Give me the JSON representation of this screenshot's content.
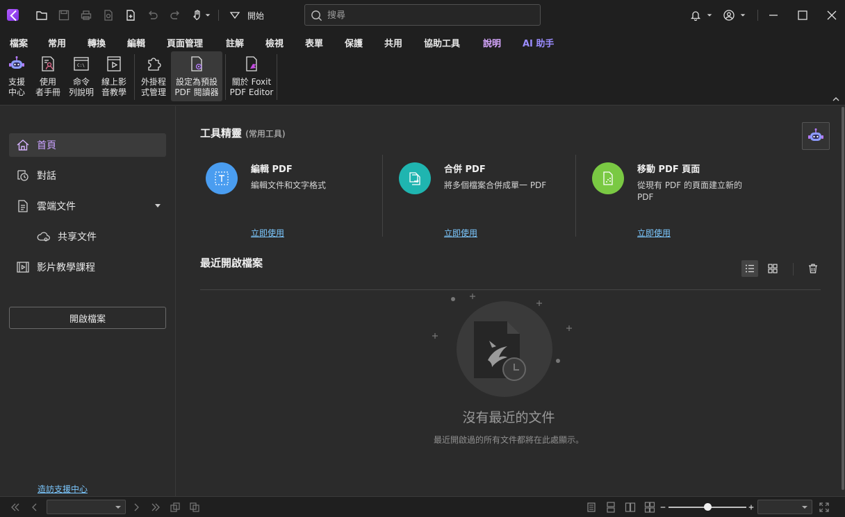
{
  "titlebar": {
    "mode_label": "開始",
    "search_placeholder": "搜尋"
  },
  "menu": {
    "tabs": [
      {
        "label": "檔案"
      },
      {
        "label": "常用"
      },
      {
        "label": "轉換"
      },
      {
        "label": "編輯"
      },
      {
        "label": "頁面管理"
      },
      {
        "label": "註解"
      },
      {
        "label": "檢視"
      },
      {
        "label": "表單"
      },
      {
        "label": "保護"
      },
      {
        "label": "共用"
      },
      {
        "label": "協助工具"
      },
      {
        "label": "說明"
      },
      {
        "label": "AI 助手"
      }
    ],
    "active_tab": "說明"
  },
  "ribbon": {
    "buttons": [
      {
        "label": "支援\n中心",
        "icon": "robot-support-icon"
      },
      {
        "label": "使用\n者手冊",
        "icon": "user-manual-icon"
      },
      {
        "label": "命令\n列說明",
        "icon": "command-line-icon"
      },
      {
        "label": "線上影\n音教學",
        "icon": "video-tutorial-icon"
      },
      {
        "label": "外掛程\n式管理",
        "icon": "plugin-icon"
      },
      {
        "label": "設定為預設\nPDF 閱讀器",
        "icon": "default-reader-icon"
      },
      {
        "label": "關於 Foxit\nPDF Editor",
        "icon": "about-foxit-icon"
      }
    ]
  },
  "sidebar": {
    "items": [
      {
        "label": "首頁",
        "icon": "home-icon"
      },
      {
        "label": "對話",
        "icon": "chat-icon"
      },
      {
        "label": "雲端文件",
        "icon": "cloud-document-icon"
      },
      {
        "label": "共享文件",
        "icon": "cloud-shared-icon"
      },
      {
        "label": "影片教學課程",
        "icon": "video-course-icon"
      }
    ],
    "open_file_label": "開啟檔案",
    "support_link": "造訪支援中心"
  },
  "main": {
    "tools_title": "工具精靈",
    "tools_subtitle": "(常用工具)",
    "tools": [
      {
        "title": "編輯 PDF",
        "desc": "編輯文件和文字格式",
        "link": "立即使用",
        "color": "#4a9df0",
        "icon": "edit-text-icon"
      },
      {
        "title": "合併 PDF",
        "desc": "將多個檔案合併成單一 PDF",
        "link": "立即使用",
        "color": "#1fb5b0",
        "icon": "merge-files-icon"
      },
      {
        "title": "移動 PDF 頁面",
        "desc": "從現有 PDF 的頁面建立新的 PDF",
        "link": "立即使用",
        "color": "#7ac943",
        "icon": "move-pages-icon"
      }
    ],
    "recent_title": "最近開啟檔案",
    "empty_title": "沒有最近的文件",
    "empty_desc": "最近開啟過的所有文件都將在此處顯示。"
  },
  "colors": {
    "accent": "#b57cff",
    "link": "#7cc8ff",
    "background": "#2b2b2b",
    "chrome": "#1f1f1f"
  }
}
